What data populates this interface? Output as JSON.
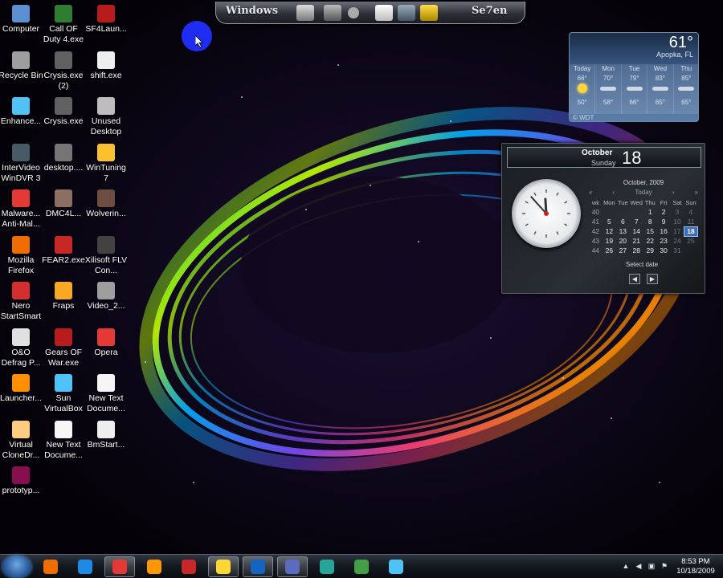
{
  "dock": {
    "left_label": "Windows",
    "right_label": "Se7en"
  },
  "desktop_icons": [
    {
      "label": "Computer",
      "icon": "computer-icon"
    },
    {
      "label": "Call OF Duty 4.exe",
      "icon": "cod4-icon"
    },
    {
      "label": "SF4Laun...",
      "icon": "sf4-icon"
    },
    {
      "label": "Recycle Bin",
      "icon": "recycle-bin-icon"
    },
    {
      "label": "Crysis.exe (2)",
      "icon": "crysis-icon"
    },
    {
      "label": "shift.exe",
      "icon": "shift-icon"
    },
    {
      "label": "Enhance...",
      "icon": "enhance-icon"
    },
    {
      "label": "Crysis.exe",
      "icon": "crysis-icon"
    },
    {
      "label": "Unused Desktop",
      "icon": "unused-desktop-icon"
    },
    {
      "label": "InterVideo WinDVR 3",
      "icon": "windvr-icon"
    },
    {
      "label": "desktop....",
      "icon": "desktop-file-icon"
    },
    {
      "label": "WinTuning 7",
      "icon": "wintuning-icon"
    },
    {
      "label": "Malware... Anti-Mal...",
      "icon": "malwarebytes-icon"
    },
    {
      "label": "DMC4L...",
      "icon": "dmc4-icon"
    },
    {
      "label": "Wolverin...",
      "icon": "wolverine-icon"
    },
    {
      "label": "Mozilla Firefox",
      "icon": "firefox-icon"
    },
    {
      "label": "FEAR2.exe",
      "icon": "fear2-icon"
    },
    {
      "label": "Xilisoft FLV Con...",
      "icon": "xilisoft-icon"
    },
    {
      "label": "Nero StartSmart",
      "icon": "nero-icon"
    },
    {
      "label": "Fraps",
      "icon": "fraps-icon"
    },
    {
      "label": "Video_2...",
      "icon": "video-icon"
    },
    {
      "label": "O&O Defrag P...",
      "icon": "defrag-icon"
    },
    {
      "label": "Gears OF War.exe",
      "icon": "gears-icon"
    },
    {
      "label": "Opera",
      "icon": "opera-icon"
    },
    {
      "label": "Launcher...",
      "icon": "launcher-icon"
    },
    {
      "label": "Sun VirtualBox",
      "icon": "virtualbox-icon"
    },
    {
      "label": "New Text Docume...",
      "icon": "text-document-icon"
    },
    {
      "label": "Virtual CloneDr...",
      "icon": "clonedrive-icon"
    },
    {
      "label": "New Text Docume...",
      "icon": "text-document-icon"
    },
    {
      "label": "BmStart...",
      "icon": "bmstart-icon"
    },
    {
      "label": "prototyp...",
      "icon": "prototype-icon"
    }
  ],
  "weather": {
    "temperature": "61°",
    "location": "Apopka, FL",
    "source": "© WDT",
    "days": [
      {
        "name": "Today",
        "high": "66°",
        "low": "50°",
        "cond": "sunny"
      },
      {
        "name": "Mon",
        "high": "70°",
        "low": "58°",
        "cond": "cloudy"
      },
      {
        "name": "Tue",
        "high": "79°",
        "low": "66°",
        "cond": "cloudy"
      },
      {
        "name": "Wed",
        "high": "83°",
        "low": "65°",
        "cond": "cloudy"
      },
      {
        "name": "Thu",
        "high": "85°",
        "low": "65°",
        "cond": "cloudy"
      }
    ]
  },
  "calendar": {
    "month": "October",
    "weekday": "Sunday",
    "day": "18",
    "month_year": "October, 2009",
    "today_label": "Today",
    "select_date": "Select date",
    "headers": [
      "wk",
      "Mon",
      "Tue",
      "Wed",
      "Thu",
      "Fri",
      "Sat",
      "Sun"
    ],
    "weeks": [
      [
        "40",
        "",
        "",
        "",
        "1",
        "2",
        "3",
        "4"
      ],
      [
        "41",
        "5",
        "6",
        "7",
        "8",
        "9",
        "10",
        "11"
      ],
      [
        "42",
        "12",
        "13",
        "14",
        "15",
        "16",
        "17",
        "18"
      ],
      [
        "43",
        "19",
        "20",
        "21",
        "22",
        "23",
        "24",
        "25"
      ],
      [
        "44",
        "26",
        "27",
        "28",
        "29",
        "30",
        "31",
        ""
      ]
    ]
  },
  "clock_face": {
    "hour": 11,
    "minute": 53
  },
  "taskbar": {
    "apps": [
      "firefox-icon",
      "ie-icon",
      "opera-icon",
      "media-player-icon",
      "red-app-icon",
      "folder-icon",
      "word-icon",
      "explorer-icon",
      "gallery-icon",
      "users-icon",
      "virtualbox-icon"
    ],
    "time": "8:53 PM",
    "date": "10/18/2009"
  }
}
